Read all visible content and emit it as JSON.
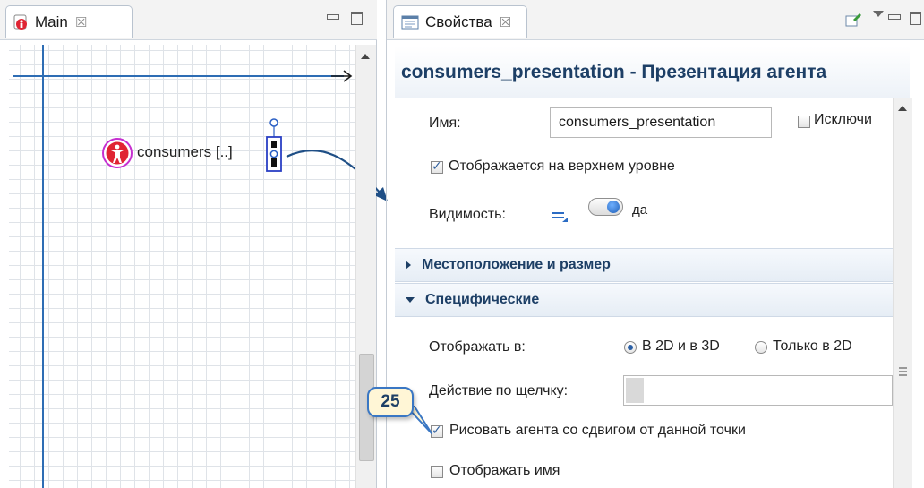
{
  "left_view": {
    "tab_label": "Main",
    "agent_label": "consumers [..]"
  },
  "right_view": {
    "tab_label": "Свойства",
    "title": "consumers_presentation - Презентация агента",
    "name_label": "Имя:",
    "name_value": "consumers_presentation",
    "exclude_label": "Исключи",
    "show_top_level_label": "Отображается на верхнем уровне",
    "visibility_label": "Видимость:",
    "visibility_value": "да",
    "section_location": "Местоположение и размер",
    "section_specific": "Специфические",
    "display_in_label": "Отображать в:",
    "display_option_2d3d": "В 2D и в 3D",
    "display_option_2d": "Только в 2D",
    "click_action_label": "Действие по щелчку:",
    "draw_offset_label": "Рисовать агента со сдвигом от данной точки",
    "show_name_label": "Отображать имя"
  },
  "callout": {
    "number": "25"
  },
  "state": {
    "exclude_checked": false,
    "show_top_level_checked": true,
    "display_in_selected": "2D+3D",
    "draw_offset_checked": true,
    "show_name_checked": false,
    "visibility_toggle_on": true
  },
  "colors": {
    "accent": "#1d3f66",
    "axis": "#2e6db4",
    "agent_icon": "#e02433",
    "callout_fill": "#fff6d6",
    "callout_border": "#3a77c4"
  }
}
